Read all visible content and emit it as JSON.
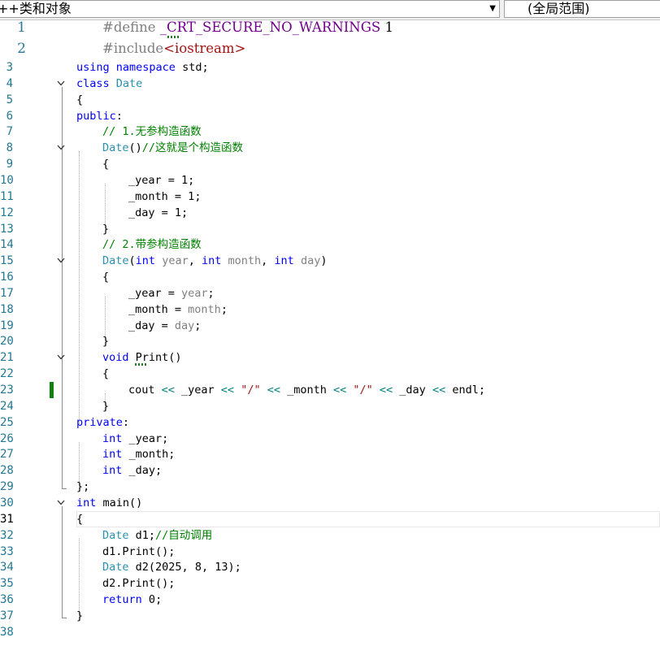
{
  "scope_bar": {
    "type_scope": "++类和对象",
    "member_scope": "(全局范围)"
  },
  "current_line": 31,
  "changed_line": 23,
  "code_lines": [
    {
      "n": "1",
      "indent": 1,
      "fold": false,
      "tokens": [
        {
          "t": "#define ",
          "c": "pp"
        },
        {
          "t": "_CRT_SECURE_NO_WARNINGS",
          "c": "mac"
        },
        {
          "t": " 1",
          "c": "nm"
        }
      ]
    },
    {
      "n": "2",
      "indent": 1,
      "fold": false,
      "tokens": [
        {
          "t": "#include",
          "c": "pp"
        },
        {
          "t": "<iostream>",
          "c": "st"
        }
      ]
    },
    {
      "n": "3",
      "indent": 0,
      "fold": false,
      "tokens": [
        {
          "t": "using",
          "c": "kw"
        },
        {
          "t": " ",
          "c": "tx"
        },
        {
          "t": "namespace",
          "c": "kw"
        },
        {
          "t": " std;",
          "c": "tx"
        }
      ]
    },
    {
      "n": "4",
      "indent": 0,
      "fold": true,
      "tokens": [
        {
          "t": "class",
          "c": "kw"
        },
        {
          "t": " ",
          "c": "tx"
        },
        {
          "t": "Date",
          "c": "ty"
        }
      ]
    },
    {
      "n": "5",
      "indent": 0,
      "fold": false,
      "tokens": [
        {
          "t": "{",
          "c": "tx"
        }
      ]
    },
    {
      "n": "6",
      "indent": 0,
      "fold": false,
      "tokens": [
        {
          "t": "public",
          "c": "kw"
        },
        {
          "t": ":",
          "c": "tx"
        }
      ]
    },
    {
      "n": "7",
      "indent": 1,
      "fold": false,
      "tokens": [
        {
          "t": "// 1.无参构造函数",
          "c": "cm"
        }
      ]
    },
    {
      "n": "8",
      "indent": 1,
      "fold": true,
      "tokens": [
        {
          "t": "Date",
          "c": "ty"
        },
        {
          "t": "()",
          "c": "tx"
        },
        {
          "t": "//这就是个构造函数",
          "c": "cm"
        }
      ]
    },
    {
      "n": "9",
      "indent": 1,
      "fold": false,
      "tokens": [
        {
          "t": "{",
          "c": "tx"
        }
      ]
    },
    {
      "n": "10",
      "indent": 2,
      "fold": false,
      "tokens": [
        {
          "t": "_year",
          "c": "tx"
        },
        {
          "t": " = ",
          "c": "tx"
        },
        {
          "t": "1",
          "c": "nm"
        },
        {
          "t": ";",
          "c": "tx"
        }
      ]
    },
    {
      "n": "11",
      "indent": 2,
      "fold": false,
      "tokens": [
        {
          "t": "_month",
          "c": "tx"
        },
        {
          "t": " = ",
          "c": "tx"
        },
        {
          "t": "1",
          "c": "nm"
        },
        {
          "t": ";",
          "c": "tx"
        }
      ]
    },
    {
      "n": "12",
      "indent": 2,
      "fold": false,
      "tokens": [
        {
          "t": "_day",
          "c": "tx"
        },
        {
          "t": " = ",
          "c": "tx"
        },
        {
          "t": "1",
          "c": "nm"
        },
        {
          "t": ";",
          "c": "tx"
        }
      ]
    },
    {
      "n": "13",
      "indent": 1,
      "fold": false,
      "tokens": [
        {
          "t": "}",
          "c": "tx"
        }
      ]
    },
    {
      "n": "14",
      "indent": 1,
      "fold": false,
      "tokens": [
        {
          "t": "// 2.带参构造函数",
          "c": "cm"
        }
      ]
    },
    {
      "n": "15",
      "indent": 1,
      "fold": true,
      "tokens": [
        {
          "t": "Date",
          "c": "ty"
        },
        {
          "t": "(",
          "c": "tx"
        },
        {
          "t": "int",
          "c": "kw"
        },
        {
          "t": " ",
          "c": "tx"
        },
        {
          "t": "year",
          "c": "pm"
        },
        {
          "t": ", ",
          "c": "tx"
        },
        {
          "t": "int",
          "c": "kw"
        },
        {
          "t": " ",
          "c": "tx"
        },
        {
          "t": "month",
          "c": "pm"
        },
        {
          "t": ", ",
          "c": "tx"
        },
        {
          "t": "int",
          "c": "kw"
        },
        {
          "t": " ",
          "c": "tx"
        },
        {
          "t": "day",
          "c": "pm"
        },
        {
          "t": ")",
          "c": "tx"
        }
      ]
    },
    {
      "n": "16",
      "indent": 1,
      "fold": false,
      "tokens": [
        {
          "t": "{",
          "c": "tx"
        }
      ]
    },
    {
      "n": "17",
      "indent": 2,
      "fold": false,
      "tokens": [
        {
          "t": "_year",
          "c": "tx"
        },
        {
          "t": " = ",
          "c": "tx"
        },
        {
          "t": "year",
          "c": "pm"
        },
        {
          "t": ";",
          "c": "tx"
        }
      ]
    },
    {
      "n": "18",
      "indent": 2,
      "fold": false,
      "tokens": [
        {
          "t": "_month",
          "c": "tx"
        },
        {
          "t": " = ",
          "c": "tx"
        },
        {
          "t": "month",
          "c": "pm"
        },
        {
          "t": ";",
          "c": "tx"
        }
      ]
    },
    {
      "n": "19",
      "indent": 2,
      "fold": false,
      "tokens": [
        {
          "t": "_day",
          "c": "tx"
        },
        {
          "t": " = ",
          "c": "tx"
        },
        {
          "t": "day",
          "c": "pm"
        },
        {
          "t": ";",
          "c": "tx"
        }
      ]
    },
    {
      "n": "20",
      "indent": 1,
      "fold": false,
      "tokens": [
        {
          "t": "}",
          "c": "tx"
        }
      ]
    },
    {
      "n": "21",
      "indent": 1,
      "fold": true,
      "tokens": [
        {
          "t": "void",
          "c": "kw"
        },
        {
          "t": " ",
          "c": "tx"
        },
        {
          "t": "Print",
          "c": "fn"
        },
        {
          "t": "()",
          "c": "tx"
        }
      ]
    },
    {
      "n": "22",
      "indent": 1,
      "fold": false,
      "tokens": [
        {
          "t": "{",
          "c": "tx"
        }
      ]
    },
    {
      "n": "23",
      "indent": 2,
      "fold": false,
      "tokens": [
        {
          "t": "cout",
          "c": "tx"
        },
        {
          "t": " << ",
          "c": "op"
        },
        {
          "t": "_year",
          "c": "tx"
        },
        {
          "t": " << ",
          "c": "op"
        },
        {
          "t": "\"/\"",
          "c": "st"
        },
        {
          "t": " << ",
          "c": "op"
        },
        {
          "t": "_month",
          "c": "tx"
        },
        {
          "t": " << ",
          "c": "op"
        },
        {
          "t": "\"/\"",
          "c": "st"
        },
        {
          "t": " << ",
          "c": "op"
        },
        {
          "t": "_day",
          "c": "tx"
        },
        {
          "t": " << ",
          "c": "op"
        },
        {
          "t": "endl;",
          "c": "tx"
        }
      ]
    },
    {
      "n": "24",
      "indent": 1,
      "fold": false,
      "tokens": [
        {
          "t": "}",
          "c": "tx"
        }
      ]
    },
    {
      "n": "25",
      "indent": 0,
      "fold": false,
      "tokens": [
        {
          "t": "private",
          "c": "kw"
        },
        {
          "t": ":",
          "c": "tx"
        }
      ]
    },
    {
      "n": "26",
      "indent": 1,
      "fold": false,
      "tokens": [
        {
          "t": "int",
          "c": "kw"
        },
        {
          "t": " _year;",
          "c": "tx"
        }
      ]
    },
    {
      "n": "27",
      "indent": 1,
      "fold": false,
      "tokens": [
        {
          "t": "int",
          "c": "kw"
        },
        {
          "t": " _month;",
          "c": "tx"
        }
      ]
    },
    {
      "n": "28",
      "indent": 1,
      "fold": false,
      "tokens": [
        {
          "t": "int",
          "c": "kw"
        },
        {
          "t": " _day;",
          "c": "tx"
        }
      ]
    },
    {
      "n": "29",
      "indent": 0,
      "fold": false,
      "tokens": [
        {
          "t": "};",
          "c": "tx"
        }
      ]
    },
    {
      "n": "30",
      "indent": 0,
      "fold": true,
      "tokens": [
        {
          "t": "int",
          "c": "kw"
        },
        {
          "t": " ",
          "c": "tx"
        },
        {
          "t": "main",
          "c": "fn"
        },
        {
          "t": "()",
          "c": "tx"
        }
      ]
    },
    {
      "n": "31",
      "indent": 0,
      "fold": false,
      "tokens": [
        {
          "t": "{",
          "c": "tx"
        }
      ]
    },
    {
      "n": "32",
      "indent": 1,
      "fold": false,
      "tokens": [
        {
          "t": "Date",
          "c": "ty"
        },
        {
          "t": " d1;",
          "c": "tx"
        },
        {
          "t": "//自动调用",
          "c": "cm"
        }
      ]
    },
    {
      "n": "33",
      "indent": 1,
      "fold": false,
      "tokens": [
        {
          "t": "d1.",
          "c": "tx"
        },
        {
          "t": "Print",
          "c": "fn"
        },
        {
          "t": "();",
          "c": "tx"
        }
      ]
    },
    {
      "n": "34",
      "indent": 1,
      "fold": false,
      "tokens": [
        {
          "t": "Date",
          "c": "ty"
        },
        {
          "t": " d2(",
          "c": "tx"
        },
        {
          "t": "2025",
          "c": "nm"
        },
        {
          "t": ", ",
          "c": "tx"
        },
        {
          "t": "8",
          "c": "nm"
        },
        {
          "t": ", ",
          "c": "tx"
        },
        {
          "t": "13",
          "c": "nm"
        },
        {
          "t": ");",
          "c": "tx"
        }
      ]
    },
    {
      "n": "35",
      "indent": 1,
      "fold": false,
      "tokens": [
        {
          "t": "d2.",
          "c": "tx"
        },
        {
          "t": "Print",
          "c": "fn"
        },
        {
          "t": "();",
          "c": "tx"
        }
      ]
    },
    {
      "n": "36",
      "indent": 1,
      "fold": false,
      "tokens": [
        {
          "t": "return",
          "c": "kw"
        },
        {
          "t": " ",
          "c": "tx"
        },
        {
          "t": "0",
          "c": "nm"
        },
        {
          "t": ";",
          "c": "tx"
        }
      ]
    },
    {
      "n": "37",
      "indent": 0,
      "fold": false,
      "tokens": [
        {
          "t": "}",
          "c": "tx"
        }
      ]
    },
    {
      "n": "38",
      "indent": 0,
      "fold": false,
      "tokens": []
    }
  ],
  "icons": {
    "dropdown": "chevron-down-icon",
    "fold": "collapse-chevron-icon"
  }
}
